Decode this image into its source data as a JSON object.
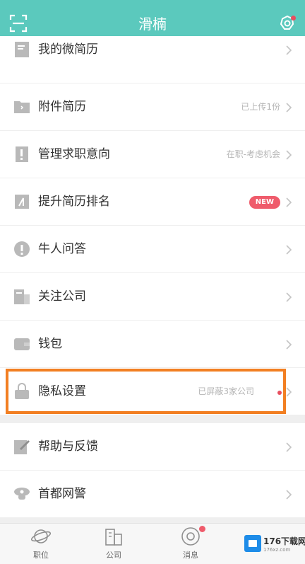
{
  "header": {
    "title": "滑楠",
    "left_icon": "scan-icon",
    "right_icon": "settings-gear-icon",
    "accent": "#5bc9bd"
  },
  "menu": [
    {
      "label": "我的微简历",
      "extra": "",
      "icon": "resume-icon"
    },
    {
      "label": "附件简历",
      "extra": "已上传1份",
      "icon": "folder-icon"
    },
    {
      "label": "管理求职意向",
      "extra": "在职-考虑机会",
      "icon": "document-icon"
    },
    {
      "label": "提升简历排名",
      "extra": "",
      "badge": "NEW",
      "icon": "ranking-icon"
    },
    {
      "label": "牛人问答",
      "extra": "",
      "icon": "qa-icon"
    },
    {
      "label": "关注公司",
      "extra": "",
      "icon": "company-icon"
    },
    {
      "label": "钱包",
      "extra": "",
      "icon": "wallet-icon"
    },
    {
      "label": "隐私设置",
      "extra": "已屏蔽3家公司",
      "icon": "lock-icon",
      "dot": true
    },
    {
      "label": "帮助与反馈",
      "extra": "",
      "icon": "edit-icon"
    },
    {
      "label": "首都网警",
      "extra": "",
      "icon": "police-icon"
    }
  ],
  "tabs": [
    {
      "label": "职位",
      "icon": "planet-icon"
    },
    {
      "label": "公司",
      "icon": "building-icon"
    },
    {
      "label": "消息",
      "icon": "message-icon",
      "dot": true
    }
  ],
  "watermark": {
    "text": "176下载网",
    "sub": "176xz.com"
  }
}
